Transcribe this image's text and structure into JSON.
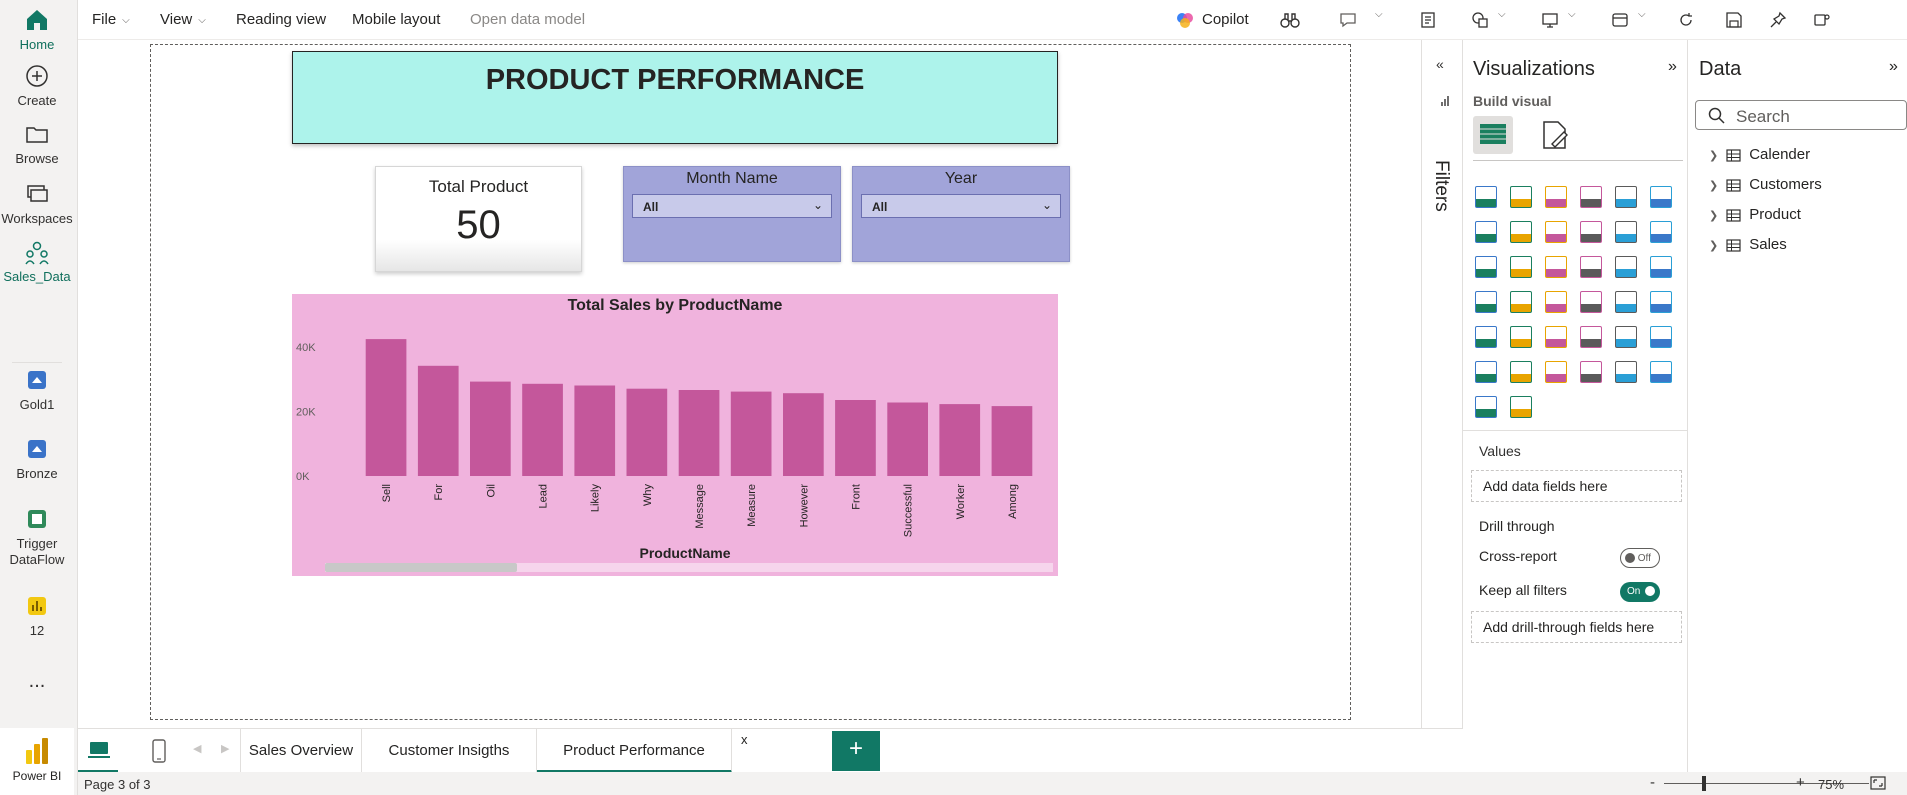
{
  "topbar": {
    "file": "File",
    "view": "View",
    "reading_view": "Reading view",
    "mobile_layout": "Mobile layout",
    "open_data_model": "Open data model",
    "copilot": "Copilot"
  },
  "rail": {
    "items": [
      {
        "label": "Home"
      },
      {
        "label": "Create"
      },
      {
        "label": "Browse"
      },
      {
        "label": "Workspaces"
      },
      {
        "label": "Sales_Data"
      },
      {
        "label": "Gold1"
      },
      {
        "label": "Bronze"
      },
      {
        "label": "Trigger DataFlow"
      },
      {
        "label": "12"
      }
    ],
    "more": "...",
    "product": "Power BI"
  },
  "report": {
    "title": "PRODUCT PERFORMANCE",
    "kpi": {
      "label": "Total Product",
      "value": "50"
    },
    "slicers": [
      {
        "label": "Month Name",
        "value": "All"
      },
      {
        "label": "Year",
        "value": "All"
      }
    ]
  },
  "chart_data": {
    "type": "bar",
    "title": "Total Sales by ProductName",
    "xlabel": "ProductName",
    "ylabel": "",
    "categories": [
      "Sell",
      "For",
      "Oil",
      "Lead",
      "Likely",
      "Why",
      "Message",
      "Measure",
      "However",
      "Front",
      "Successful",
      "Worker",
      "Among"
    ],
    "values": [
      42500,
      34200,
      29300,
      28600,
      28100,
      27100,
      26700,
      26200,
      25700,
      23600,
      22800,
      22300,
      21700
    ],
    "ylim": [
      0,
      45000
    ],
    "yticks": [
      {
        "v": 0,
        "label": "0K"
      },
      {
        "v": 20000,
        "label": "20K"
      },
      {
        "v": 40000,
        "label": "40K"
      }
    ],
    "bar_color": "#c4579b",
    "background": "#f0b3dd"
  },
  "filters_pane": {
    "label": "Filters"
  },
  "visualizations": {
    "title": "Visualizations",
    "build_visual": "Build visual",
    "more": "...",
    "values_label": "Values",
    "values_drop": "Add data fields here",
    "drill_through": "Drill through",
    "cross_report": "Cross-report",
    "cross_report_state": "Off",
    "keep_all_filters": "Keep all filters",
    "keep_all_filters_state": "On",
    "drill_drop": "Add drill-through fields here"
  },
  "data_pane": {
    "title": "Data",
    "search_placeholder": "Search",
    "tables": [
      "Calender",
      "Customers",
      "Product",
      "Sales"
    ]
  },
  "tabs": [
    {
      "label": "Sales Overview"
    },
    {
      "label": "Customer Insigths"
    },
    {
      "label": "Product Performance"
    }
  ],
  "tab_close": "x",
  "add_tab": "+",
  "status": {
    "page": "Page 3 of 3",
    "zoom": "75%",
    "zoom_minus": "-",
    "zoom_plus": "+"
  },
  "colors": {
    "accent": "#117865",
    "title_bg": "#adf3eb",
    "slicer_bg": "#a1a4d9",
    "chart_bg": "#f0b3dd"
  }
}
